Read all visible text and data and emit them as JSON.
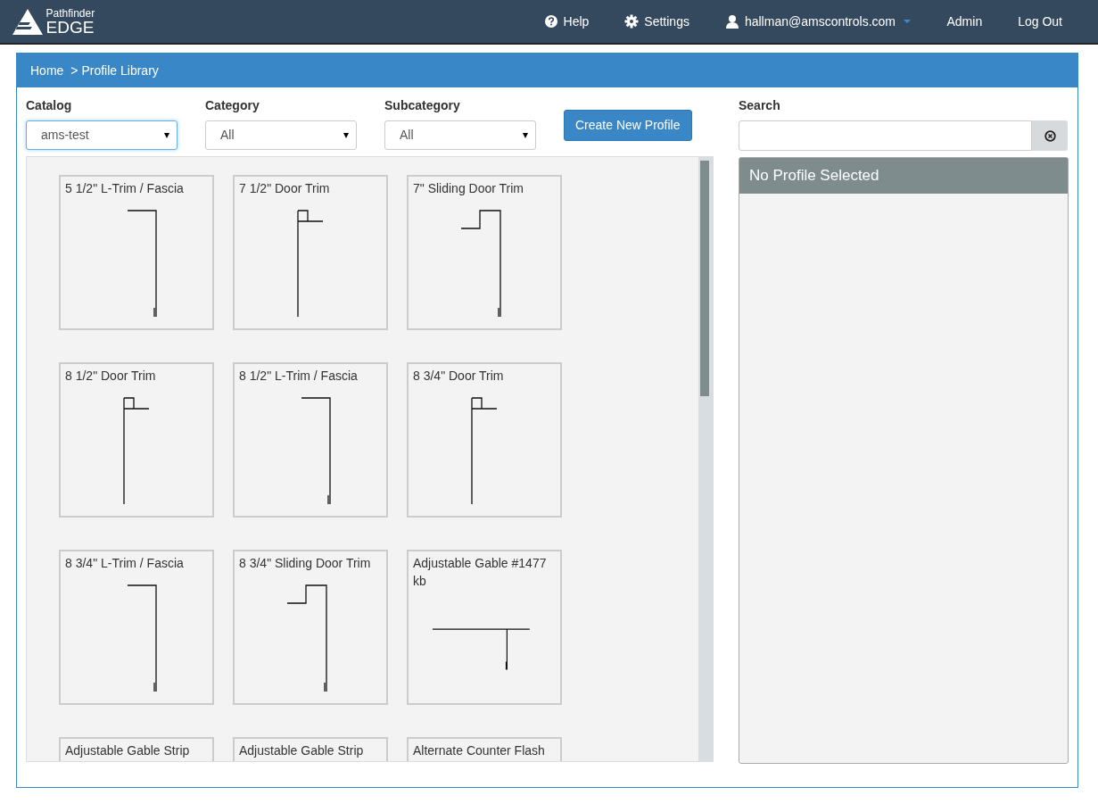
{
  "navbar": {
    "brand_top": "Pathfinder",
    "brand_bottom": "EDGE",
    "links": [
      {
        "kind": "help",
        "label": "Help"
      },
      {
        "kind": "settings",
        "label": "Settings"
      },
      {
        "kind": "user",
        "label": "hallman@amscontrols.com"
      },
      {
        "kind": "plain",
        "label": "Admin"
      },
      {
        "kind": "plain",
        "label": "Log Out"
      }
    ]
  },
  "breadcrumb": [
    "Home",
    "> Profile Library"
  ],
  "filters": [
    {
      "label": "Catalog",
      "value": "ams-test",
      "focused": true
    },
    {
      "label": "Category",
      "value": "All",
      "focused": false
    },
    {
      "label": "Subcategory",
      "value": "All",
      "focused": false
    }
  ],
  "create_button": "Create New Profile",
  "search": {
    "label": "Search"
  },
  "details": {
    "title": "No Profile Selected"
  },
  "profiles": [
    {
      "name": "5 1/2\" L-Trim / Fascia",
      "kind": "l-trim"
    },
    {
      "name": "7 1/2\" Door Trim",
      "kind": "door-trim"
    },
    {
      "name": "7\" Sliding Door Trim",
      "kind": "sliding"
    },
    {
      "name": "8 1/2\" Door Trim",
      "kind": "door-trim"
    },
    {
      "name": "8 1/2\" L-Trim / Fascia",
      "kind": "l-trim"
    },
    {
      "name": "8 3/4\" Door Trim",
      "kind": "door-trim"
    },
    {
      "name": "8 3/4\" L-Trim / Fascia",
      "kind": "l-trim"
    },
    {
      "name": "8 3/4\" Sliding Door Trim",
      "kind": "sliding"
    },
    {
      "name": "Adjustable Gable #1477 kb",
      "kind": "gable"
    },
    {
      "name": "Adjustable Gable Strip",
      "kind": "hidden"
    },
    {
      "name": "Adjustable Gable Strip",
      "kind": "hidden"
    },
    {
      "name": "Alternate Counter Flash",
      "kind": "hidden"
    }
  ]
}
